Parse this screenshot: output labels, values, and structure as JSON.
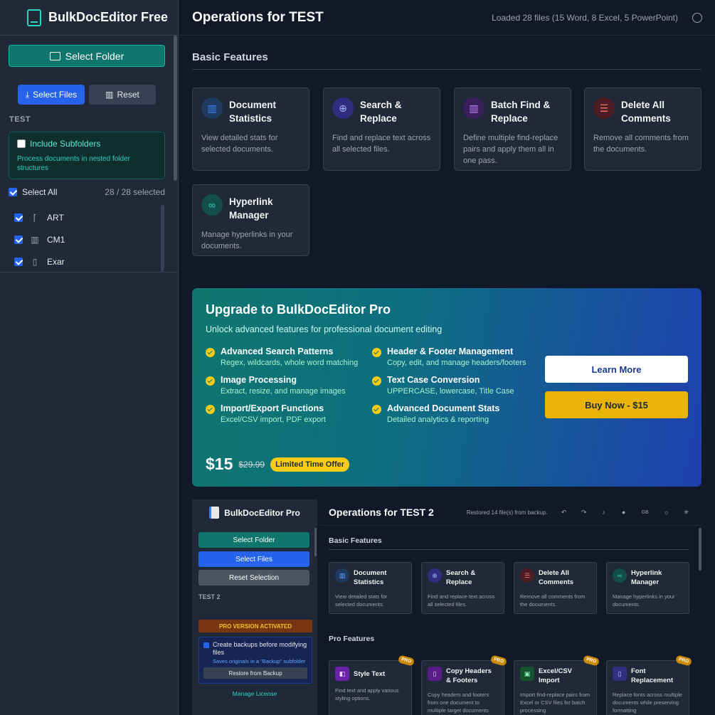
{
  "sidebar": {
    "app_title": "BulkDocEditor Free",
    "select_folder": "Select Folder",
    "select_files": "Select Files",
    "reset": "Reset",
    "section_label": "TEST",
    "include_subfolders": "Include Subfolders",
    "include_subfolders_desc": "Process documents in nested folder structures",
    "select_all": "Select All",
    "selected_count": "28 / 28 selected",
    "files": [
      {
        "name": "ART",
        "icon": "dashed-doc-icon"
      },
      {
        "name": "CM1",
        "icon": "chart-icon"
      },
      {
        "name": "Exar",
        "icon": "document-icon"
      }
    ]
  },
  "header": {
    "title": "Operations for TEST",
    "status": "Loaded 28 files (15 Word, 8 Excel, 5 PowerPoint)"
  },
  "basic": {
    "heading": "Basic Features",
    "cards": [
      {
        "title": "Document Statistics",
        "desc": "View detailed stats for selected documents.",
        "icon": "chart-icon",
        "color": "#3b82f6"
      },
      {
        "title": "Search & Replace",
        "desc": "Find and replace text across all selected files.",
        "icon": "search-icon",
        "color": "#6366f1"
      },
      {
        "title": "Batch Find & Replace",
        "desc": "Define multiple find-replace pairs and apply them all in one pass.",
        "icon": "chart-icon",
        "color": "#a855f7"
      },
      {
        "title": "Delete All Comments",
        "desc": "Remove all comments from the documents.",
        "icon": "comment-icon",
        "color": "#ef4444"
      },
      {
        "title": "Hyperlink Manager",
        "desc": "Manage hyperlinks in your documents.",
        "icon": "link-icon",
        "color": "#14b8a6"
      }
    ]
  },
  "promo": {
    "title": "Upgrade to BulkDocEditor Pro",
    "subtitle": "Unlock advanced features for professional document editing",
    "features": [
      {
        "title": "Advanced Search Patterns",
        "desc": "Regex, wildcards, whole word matching"
      },
      {
        "title": "Header & Footer Management",
        "desc": "Copy, edit, and manage headers/footers"
      },
      {
        "title": "Image Processing",
        "desc": "Extract, resize, and manage images"
      },
      {
        "title": "Text Case Conversion",
        "desc": "UPPERCASE, lowercase, Title Case"
      },
      {
        "title": "Import/Export Functions",
        "desc": "Excel/CSV import, PDF export"
      },
      {
        "title": "Advanced Document Stats",
        "desc": "Detailed analytics & reporting"
      }
    ],
    "price": "$15",
    "old_price": "$29.99",
    "badge": "Limited Time Offer",
    "learn_more": "Learn More",
    "buy_now": "Buy Now - $15"
  },
  "preview": {
    "app_title": "BulkDocEditor Pro",
    "select_folder": "Select Folder",
    "select_files": "Select Files",
    "reset_selection": "Reset Selection",
    "section_label": "TEST 2",
    "pro_activated": "PRO VERSION ACTIVATED",
    "backup_label": "Create backups before modifying files",
    "backup_desc": "Saves originals in a \"Backup\" subfolder",
    "restore": "Restore from Backup",
    "manage_license": "Manage License",
    "title": "Operations for TEST 2",
    "status": "Restored 14 file(s) from backup.",
    "lang": "GB",
    "basic_heading": "Basic Features",
    "pro_heading": "Pro Features",
    "pro_badge": "PRO",
    "basic_cards": [
      {
        "title": "Document Statistics",
        "desc": "View detailed stats for selected documents."
      },
      {
        "title": "Search & Replace",
        "desc": "Find and replace text across all selected files."
      },
      {
        "title": "Delete All Comments",
        "desc": "Remove all comments from the documents."
      },
      {
        "title": "Hyperlink Manager",
        "desc": "Manage hyperlinks in your documents."
      }
    ],
    "pro_cards": [
      {
        "title": "Style Text",
        "desc": "Find text and apply various styling options."
      },
      {
        "title": "Copy Headers & Footers",
        "desc": "Copy headers and footers from one document to multiple target documents"
      },
      {
        "title": "Excel/CSV Import",
        "desc": "Import find-replace pairs from Excel or CSV files for batch processing"
      },
      {
        "title": "Font Replacement",
        "desc": "Replace fonts across multiple documents while preserving formatting"
      }
    ]
  }
}
